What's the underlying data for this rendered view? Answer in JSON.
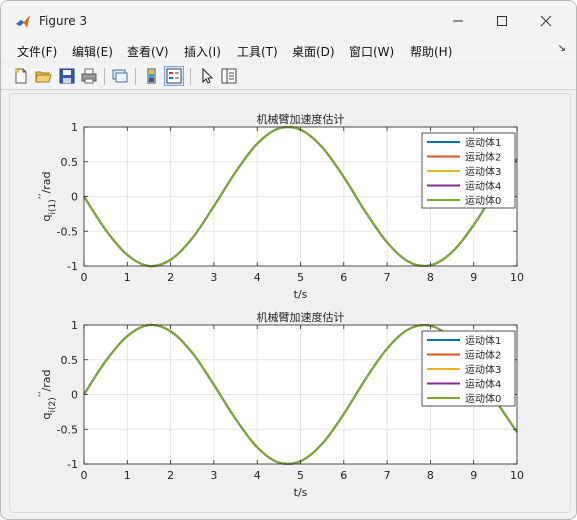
{
  "window": {
    "title": "Figure 3"
  },
  "menu": [
    "文件(F)",
    "编辑(E)",
    "查看(V)",
    "插入(I)",
    "工具(T)",
    "桌面(D)",
    "窗口(W)",
    "帮助(H)"
  ],
  "toolbar_icons": [
    "new-figure-icon",
    "open-icon",
    "save-icon",
    "print-icon",
    "link-icon",
    "colorbar-icon",
    "legend-icon",
    "pointer-icon",
    "property-inspector-icon"
  ],
  "colors": {
    "series": [
      "#0072BD",
      "#D95319",
      "#EDB120",
      "#7E2F8E",
      "#77AC30"
    ]
  },
  "chart_data": [
    {
      "type": "line",
      "title": "机械臂加速度估计",
      "xlabel": "t/s",
      "ylabel": "q",
      "ylabel_sub": "i(1)",
      "ylabel_sup": "’’",
      "ylabel_unit": "/rad",
      "xlim": [
        0,
        10
      ],
      "ylim": [
        -1,
        1
      ],
      "xticks": [
        0,
        1,
        2,
        3,
        4,
        5,
        6,
        7,
        8,
        9,
        10
      ],
      "yticks": [
        1,
        0.5,
        0,
        -0.5,
        -1
      ],
      "grid": true,
      "legend_position": "top-right",
      "x": [
        0,
        0.5,
        1,
        1.5,
        2,
        2.5,
        3,
        3.5,
        4,
        4.5,
        5,
        5.5,
        6,
        6.5,
        7,
        7.5,
        8,
        8.5,
        9,
        9.5,
        10
      ],
      "series": [
        {
          "name": "运动体1",
          "values": [
            0,
            -0.48,
            -0.84,
            -1.0,
            -0.91,
            -0.6,
            -0.14,
            0.35,
            0.76,
            0.98,
            0.96,
            0.71,
            0.28,
            -0.22,
            -0.66,
            -0.94,
            -0.99,
            -0.8,
            -0.41,
            0.08,
            0.54
          ]
        },
        {
          "name": "运动体2",
          "values": [
            0,
            -0.48,
            -0.84,
            -1.0,
            -0.91,
            -0.6,
            -0.14,
            0.35,
            0.76,
            0.98,
            0.96,
            0.71,
            0.28,
            -0.22,
            -0.66,
            -0.94,
            -0.99,
            -0.8,
            -0.41,
            0.08,
            0.54
          ]
        },
        {
          "name": "运动体3",
          "values": [
            0,
            -0.48,
            -0.84,
            -1.0,
            -0.91,
            -0.6,
            -0.14,
            0.35,
            0.76,
            0.98,
            0.96,
            0.71,
            0.28,
            -0.22,
            -0.66,
            -0.94,
            -0.99,
            -0.8,
            -0.41,
            0.08,
            0.54
          ]
        },
        {
          "name": "运动体4",
          "values": [
            0,
            -0.48,
            -0.84,
            -1.0,
            -0.91,
            -0.6,
            -0.14,
            0.35,
            0.76,
            0.98,
            0.96,
            0.71,
            0.28,
            -0.22,
            -0.66,
            -0.94,
            -0.99,
            -0.8,
            -0.41,
            0.08,
            0.54
          ]
        },
        {
          "name": "运动体0",
          "values": [
            0,
            -0.48,
            -0.84,
            -1.0,
            -0.91,
            -0.6,
            -0.14,
            0.35,
            0.76,
            0.98,
            0.96,
            0.71,
            0.28,
            -0.22,
            -0.66,
            -0.94,
            -0.99,
            -0.8,
            -0.41,
            0.08,
            0.54
          ]
        }
      ]
    },
    {
      "type": "line",
      "title": "机械臂加速度估计",
      "xlabel": "t/s",
      "ylabel": "q",
      "ylabel_sub": "i(2)",
      "ylabel_sup": "’’",
      "ylabel_unit": "/rad",
      "xlim": [
        0,
        10
      ],
      "ylim": [
        -1,
        1
      ],
      "xticks": [
        0,
        1,
        2,
        3,
        4,
        5,
        6,
        7,
        8,
        9,
        10
      ],
      "yticks": [
        1,
        0.5,
        0,
        -0.5,
        -1
      ],
      "grid": true,
      "legend_position": "top-right",
      "x": [
        0,
        0.5,
        1,
        1.5,
        2,
        2.5,
        3,
        3.5,
        4,
        4.5,
        5,
        5.5,
        6,
        6.5,
        7,
        7.5,
        8,
        8.5,
        9,
        9.5,
        10
      ],
      "series": [
        {
          "name": "运动体1",
          "values": [
            0,
            0.48,
            0.84,
            1.0,
            0.91,
            0.6,
            0.14,
            -0.35,
            -0.76,
            -0.98,
            -0.96,
            -0.71,
            -0.28,
            0.22,
            0.66,
            0.94,
            0.99,
            0.8,
            0.41,
            -0.08,
            -0.54
          ]
        },
        {
          "name": "运动体2",
          "values": [
            0,
            0.48,
            0.84,
            1.0,
            0.91,
            0.6,
            0.14,
            -0.35,
            -0.76,
            -0.98,
            -0.96,
            -0.71,
            -0.28,
            0.22,
            0.66,
            0.94,
            0.99,
            0.8,
            0.41,
            -0.08,
            -0.54
          ]
        },
        {
          "name": "运动体3",
          "values": [
            0,
            0.48,
            0.84,
            1.0,
            0.91,
            0.6,
            0.14,
            -0.35,
            -0.76,
            -0.98,
            -0.96,
            -0.71,
            -0.28,
            0.22,
            0.66,
            0.94,
            0.99,
            0.8,
            0.41,
            -0.08,
            -0.54
          ]
        },
        {
          "name": "运动体4",
          "values": [
            0,
            0.48,
            0.84,
            1.0,
            0.91,
            0.6,
            0.14,
            -0.35,
            -0.76,
            -0.98,
            -0.96,
            -0.71,
            -0.28,
            0.22,
            0.66,
            0.94,
            0.99,
            0.8,
            0.41,
            -0.08,
            -0.54
          ]
        },
        {
          "name": "运动体0",
          "values": [
            0,
            0.48,
            0.84,
            1.0,
            0.91,
            0.6,
            0.14,
            -0.35,
            -0.76,
            -0.98,
            -0.96,
            -0.71,
            -0.28,
            0.22,
            0.66,
            0.94,
            0.99,
            0.8,
            0.41,
            -0.08,
            -0.54
          ]
        }
      ]
    }
  ]
}
